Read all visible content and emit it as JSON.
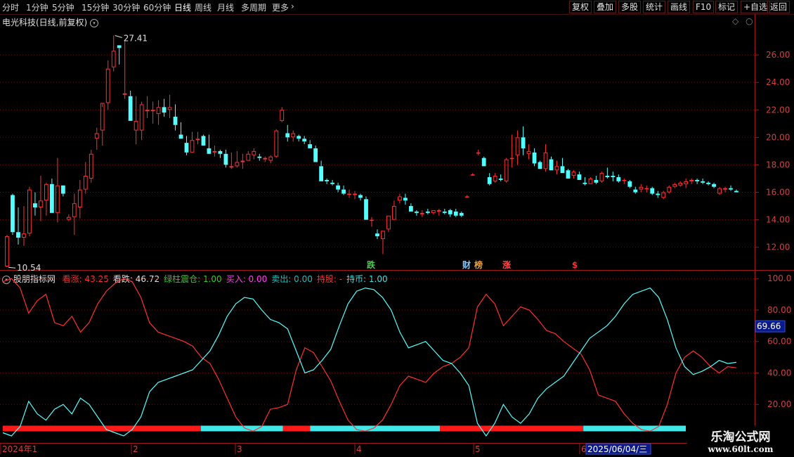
{
  "toolbar": {
    "periods": [
      "分时",
      "1分钟",
      "5分钟",
      "15分钟",
      "30分钟",
      "60分钟",
      "日线",
      "周线",
      "月线",
      "多周期",
      "更多"
    ],
    "active_period": "日线",
    "right_buttons": [
      "复权",
      "叠加",
      "多股",
      "统计",
      "画线",
      "F10",
      "标记",
      "+自选",
      "返回"
    ]
  },
  "stock": {
    "title": "电光科技(日线,前复权)"
  },
  "price_panel": {
    "high_label": "27.41",
    "low_label": "10.54",
    "y_ticks": [
      "26.00",
      "24.00",
      "22.00",
      "20.00",
      "18.00",
      "16.00",
      "14.00",
      "12.00"
    ],
    "event_markers": [
      {
        "label": "跌",
        "color": "#4ec74e"
      },
      {
        "label": "财",
        "color": "#7fc8ff"
      },
      {
        "label": "榜",
        "color": "#e8a040"
      },
      {
        "label": "涨",
        "color": "#ff5050"
      },
      {
        "label": "$",
        "color": "#ff3030"
      }
    ]
  },
  "indicator": {
    "name": "股朋指标网",
    "items": [
      {
        "label": "看涨: 43.25",
        "color": "#ff3030"
      },
      {
        "label": "看跌: 46.72",
        "color": "#e0e0e0"
      },
      {
        "label": "绿柱震仓: 1.00",
        "color": "#33cc33"
      },
      {
        "label": "买入: 0.00",
        "color": "#ff40ff"
      },
      {
        "label": "卖出: 0.00",
        "color": "#20c0c0"
      },
      {
        "label": "持股: -",
        "color": "#ff3030"
      },
      {
        "label": "持币: 1.00",
        "color": "#40e0e0"
      }
    ],
    "y_ticks": [
      "100.0",
      "80.00",
      "60.00",
      "40.00",
      "20.00"
    ],
    "current_label": "69.66"
  },
  "date_axis": {
    "labels": [
      "2024年1",
      "2",
      "3",
      "4",
      "5",
      "6"
    ],
    "highlight": "2025/06/04/三"
  },
  "watermark": {
    "title": "乐淘公式网",
    "url": "www.60lt.com"
  },
  "chart_data": [
    {
      "type": "candlestick",
      "title": "电光科技(日线,前复权)",
      "ylim": [
        10.5,
        28
      ],
      "annotations": {
        "max": 27.41,
        "min": 10.54
      },
      "up_color": "#ff3030",
      "down_color": "#54ffff",
      "ohlc": [
        [
          10.6,
          12.9,
          10.54,
          12.8
        ],
        [
          15.8,
          15.9,
          12.9,
          13.1
        ],
        [
          13.1,
          14.9,
          12.2,
          12.7
        ],
        [
          12.7,
          15.0,
          12.1,
          13.0
        ],
        [
          13.0,
          16.4,
          12.8,
          16.2
        ],
        [
          15.2,
          16.0,
          14.3,
          14.9
        ],
        [
          14.9,
          17.2,
          13.9,
          15.4
        ],
        [
          15.4,
          16.7,
          14.3,
          16.6
        ],
        [
          16.6,
          17.0,
          14.5,
          14.5
        ],
        [
          14.5,
          18.5,
          13.8,
          16.5
        ],
        [
          16.5,
          16.5,
          15.7,
          15.9
        ],
        [
          14.0,
          14.4,
          13.9,
          14.2
        ],
        [
          14.2,
          15.9,
          12.9,
          15.2
        ],
        [
          14.9,
          16.9,
          14.1,
          16.2
        ],
        [
          16.2,
          18.2,
          15.9,
          17.2
        ],
        [
          17.0,
          19.1,
          16.7,
          18.8
        ],
        [
          19.9,
          20.7,
          19.1,
          20.3
        ],
        [
          20.5,
          22.2,
          19.4,
          22.5
        ],
        [
          22.5,
          25.6,
          22.0,
          25.0
        ],
        [
          25.1,
          27.41,
          24.8,
          26.3
        ],
        [
          26.7,
          26.7,
          25.3,
          26.5
        ],
        [
          23.1,
          27.0,
          22.8,
          23.2
        ],
        [
          23.0,
          23.4,
          21.3,
          21.2
        ],
        [
          20.5,
          23.0,
          19.5,
          21.2
        ],
        [
          20.5,
          22.6,
          19.8,
          22.4
        ],
        [
          21.9,
          23.0,
          21.4,
          22.0
        ],
        [
          21.9,
          22.6,
          21.0,
          22.0
        ],
        [
          21.7,
          22.7,
          20.9,
          22.2
        ],
        [
          22.2,
          22.8,
          21.5,
          21.8
        ],
        [
          22.0,
          23.1,
          21.4,
          22.2
        ],
        [
          21.5,
          22.4,
          20.5,
          20.9
        ],
        [
          20.2,
          21.1,
          19.9,
          19.9
        ],
        [
          19.6,
          20.1,
          18.7,
          18.9
        ],
        [
          18.9,
          20.4,
          18.9,
          19.8
        ],
        [
          19.8,
          20.4,
          19.5,
          19.9
        ],
        [
          20.1,
          20.2,
          19.6,
          19.4
        ],
        [
          19.2,
          20.2,
          19.3,
          18.8
        ],
        [
          18.9,
          19.4,
          18.6,
          19.0
        ],
        [
          19.0,
          19.1,
          18.5,
          18.8
        ],
        [
          18.8,
          19.1,
          17.8,
          18.0
        ],
        [
          17.8,
          18.9,
          17.7,
          17.9
        ],
        [
          17.9,
          19.0,
          17.8,
          18.2
        ],
        [
          18.2,
          18.8,
          17.7,
          18.3
        ],
        [
          18.3,
          19.0,
          18.3,
          18.8
        ],
        [
          18.7,
          19.2,
          18.4,
          19.0
        ],
        [
          18.6,
          18.8,
          18.3,
          18.5
        ],
        [
          18.4,
          18.6,
          18.2,
          18.5
        ],
        [
          18.3,
          18.7,
          18.1,
          18.6
        ],
        [
          18.6,
          20.6,
          18.5,
          20.5
        ],
        [
          21.2,
          22.2,
          21.1,
          22.0
        ],
        [
          20.3,
          20.9,
          19.7,
          20.0
        ],
        [
          20.0,
          20.5,
          19.7,
          20.3
        ],
        [
          20.1,
          20.2,
          19.7,
          19.9
        ],
        [
          19.9,
          20.1,
          19.5,
          19.7
        ],
        [
          19.5,
          19.8,
          19.2,
          19.2
        ],
        [
          19.2,
          19.4,
          18.2,
          18.2
        ],
        [
          17.9,
          18.3,
          16.8,
          16.8
        ],
        [
          16.9,
          17.0,
          16.6,
          16.8
        ],
        [
          16.7,
          16.9,
          16.5,
          16.6
        ],
        [
          16.5,
          16.7,
          16.0,
          16.2
        ],
        [
          16.2,
          16.5,
          15.8,
          15.9
        ],
        [
          15.9,
          16.2,
          15.6,
          15.9
        ],
        [
          15.8,
          16.1,
          15.5,
          15.9
        ],
        [
          15.8,
          15.9,
          15.4,
          15.6
        ],
        [
          15.5,
          15.7,
          14.0,
          14.0
        ],
        [
          14.0,
          14.2,
          13.5,
          14.0
        ],
        [
          13.0,
          13.3,
          12.6,
          12.8
        ],
        [
          12.6,
          13.2,
          11.5,
          13.2
        ],
        [
          13.3,
          14.3,
          13.1,
          14.3
        ],
        [
          14.0,
          15.4,
          14.0,
          15.0
        ],
        [
          15.4,
          15.9,
          15.2,
          15.7
        ],
        [
          15.6,
          15.9,
          15.1,
          15.4
        ],
        [
          15.0,
          15.2,
          14.6,
          14.6
        ],
        [
          14.6,
          14.7,
          14.3,
          14.5
        ],
        [
          14.4,
          14.7,
          14.2,
          14.5
        ],
        [
          14.6,
          14.8,
          14.4,
          14.5
        ],
        [
          14.5,
          14.7,
          14.4,
          14.7
        ],
        [
          14.6,
          14.8,
          14.3,
          14.7
        ],
        [
          14.6,
          14.8,
          14.4,
          14.5
        ],
        [
          14.7,
          14.8,
          14.2,
          14.4
        ],
        [
          14.6,
          14.8,
          14.2,
          14.3
        ],
        [
          14.5,
          14.6,
          14.2,
          14.3
        ],
        [
          15.7,
          15.8,
          15.7,
          15.7
        ],
        [
          17.3,
          17.4,
          17.2,
          17.3
        ],
        [
          18.9,
          19.1,
          18.7,
          18.9
        ],
        [
          18.5,
          18.6,
          17.9,
          17.9
        ],
        [
          17.1,
          17.4,
          16.5,
          16.6
        ],
        [
          16.8,
          17.4,
          16.7,
          17.2
        ],
        [
          17.0,
          17.3,
          16.8,
          16.9
        ],
        [
          16.8,
          18.5,
          16.7,
          18.4
        ],
        [
          18.5,
          20.2,
          17.8,
          18.5
        ],
        [
          18.7,
          20.5,
          18.0,
          20.0
        ],
        [
          20.0,
          20.8,
          18.7,
          19.2
        ],
        [
          18.8,
          19.5,
          18.4,
          19.0
        ],
        [
          18.9,
          19.2,
          17.9,
          18.1
        ],
        [
          18.2,
          18.3,
          17.7,
          17.7
        ],
        [
          17.7,
          19.5,
          17.5,
          18.9
        ],
        [
          18.4,
          18.6,
          17.6,
          17.6
        ],
        [
          17.6,
          18.3,
          17.3,
          17.9
        ],
        [
          17.9,
          18.5,
          17.4,
          17.4
        ],
        [
          17.6,
          17.7,
          17.0,
          17.0
        ],
        [
          17.2,
          17.6,
          17.0,
          17.5
        ],
        [
          17.3,
          17.5,
          16.9,
          16.9
        ],
        [
          16.7,
          17.1,
          16.5,
          16.6
        ],
        [
          16.6,
          17.1,
          16.6,
          17.0
        ],
        [
          16.9,
          17.2,
          16.6,
          16.7
        ],
        [
          16.8,
          17.5,
          16.7,
          17.4
        ],
        [
          17.2,
          17.8,
          17.0,
          17.1
        ],
        [
          17.2,
          17.5,
          16.8,
          17.1
        ],
        [
          17.1,
          17.3,
          16.7,
          16.8
        ],
        [
          16.9,
          17.0,
          16.6,
          16.9
        ],
        [
          16.8,
          16.9,
          16.3,
          16.4
        ],
        [
          16.2,
          16.4,
          15.9,
          16.0
        ],
        [
          16.2,
          16.6,
          16.0,
          16.4
        ],
        [
          16.3,
          16.5,
          16.0,
          16.3
        ],
        [
          16.3,
          16.4,
          15.8,
          15.9
        ],
        [
          15.9,
          16.1,
          15.6,
          15.8
        ],
        [
          15.6,
          16.1,
          15.5,
          16.0
        ],
        [
          16.0,
          16.5,
          15.9,
          16.4
        ],
        [
          16.4,
          16.7,
          16.3,
          16.6
        ],
        [
          16.5,
          16.8,
          16.4,
          16.7
        ],
        [
          16.6,
          17.0,
          16.3,
          16.8
        ],
        [
          16.8,
          17.0,
          16.6,
          16.9
        ],
        [
          16.9,
          17.0,
          16.6,
          16.8
        ],
        [
          16.8,
          17.0,
          16.6,
          16.7
        ],
        [
          16.7,
          16.8,
          16.5,
          16.6
        ],
        [
          16.6,
          16.7,
          16.3,
          16.4
        ],
        [
          15.9,
          16.4,
          15.8,
          16.3
        ],
        [
          16.2,
          16.4,
          16.0,
          16.3
        ],
        [
          16.3,
          16.5,
          16.1,
          16.2
        ],
        [
          16.1,
          16.2,
          16.0,
          16.0
        ]
      ],
      "event_markers": [
        "跌",
        "财",
        "榜",
        "涨",
        "$"
      ]
    },
    {
      "type": "line",
      "title": "股朋指标网",
      "ylim": [
        0,
        105
      ],
      "y_ticks": [
        100,
        80,
        60,
        40,
        20
      ],
      "series": [
        {
          "name": "看涨",
          "color": "#ff3030",
          "values": [
            98,
            100,
            94,
            78,
            86,
            90,
            72,
            70,
            76,
            66,
            72,
            84,
            92,
            97,
            100,
            98,
            88,
            72,
            66,
            64,
            62,
            60,
            57,
            50,
            46,
            36,
            24,
            12,
            5,
            3,
            6,
            17,
            18,
            20,
            42,
            56,
            53,
            44,
            35,
            22,
            10,
            4,
            3,
            5,
            10,
            20,
            32,
            38,
            36,
            34,
            40,
            44,
            46,
            50,
            56,
            82,
            90,
            84,
            70,
            76,
            82,
            80,
            74,
            67,
            65,
            60,
            56,
            52,
            42,
            26,
            24,
            22,
            14,
            8,
            4,
            3,
            6,
            20,
            40,
            50,
            54,
            50,
            44,
            40,
            44,
            43.25
          ]
        },
        {
          "name": "看跌",
          "color": "#54ffff",
          "values": [
            2,
            0,
            6,
            22,
            14,
            10,
            17,
            20,
            14,
            24,
            20,
            12,
            4,
            2,
            0,
            4,
            12,
            28,
            34,
            36,
            38,
            40,
            42,
            48,
            54,
            64,
            76,
            84,
            88,
            87,
            80,
            74,
            72,
            68,
            54,
            40,
            42,
            48,
            55,
            70,
            84,
            92,
            94,
            93,
            88,
            80,
            66,
            56,
            58,
            60,
            54,
            48,
            46,
            40,
            32,
            8,
            0,
            8,
            20,
            12,
            8,
            14,
            24,
            30,
            34,
            38,
            46,
            54,
            62,
            66,
            70,
            76,
            84,
            90,
            92,
            94,
            88,
            74,
            56,
            44,
            39,
            41,
            44,
            48,
            46,
            46.72
          ]
        }
      ],
      "holding_bar": [
        {
          "state": "持股",
          "color": "#ff1a1a",
          "from": 0,
          "to": 0.29
        },
        {
          "state": "持币",
          "color": "#40e8e8",
          "from": 0.29,
          "to": 0.41
        },
        {
          "state": "持股",
          "color": "#ff1a1a",
          "from": 0.41,
          "to": 0.45
        },
        {
          "state": "持币",
          "color": "#40e8e8",
          "from": 0.45,
          "to": 0.64
        },
        {
          "state": "持股",
          "color": "#ff1a1a",
          "from": 0.64,
          "to": 0.85
        },
        {
          "state": "持币",
          "color": "#40e8e8",
          "from": 0.85,
          "to": 1.0
        }
      ]
    }
  ]
}
